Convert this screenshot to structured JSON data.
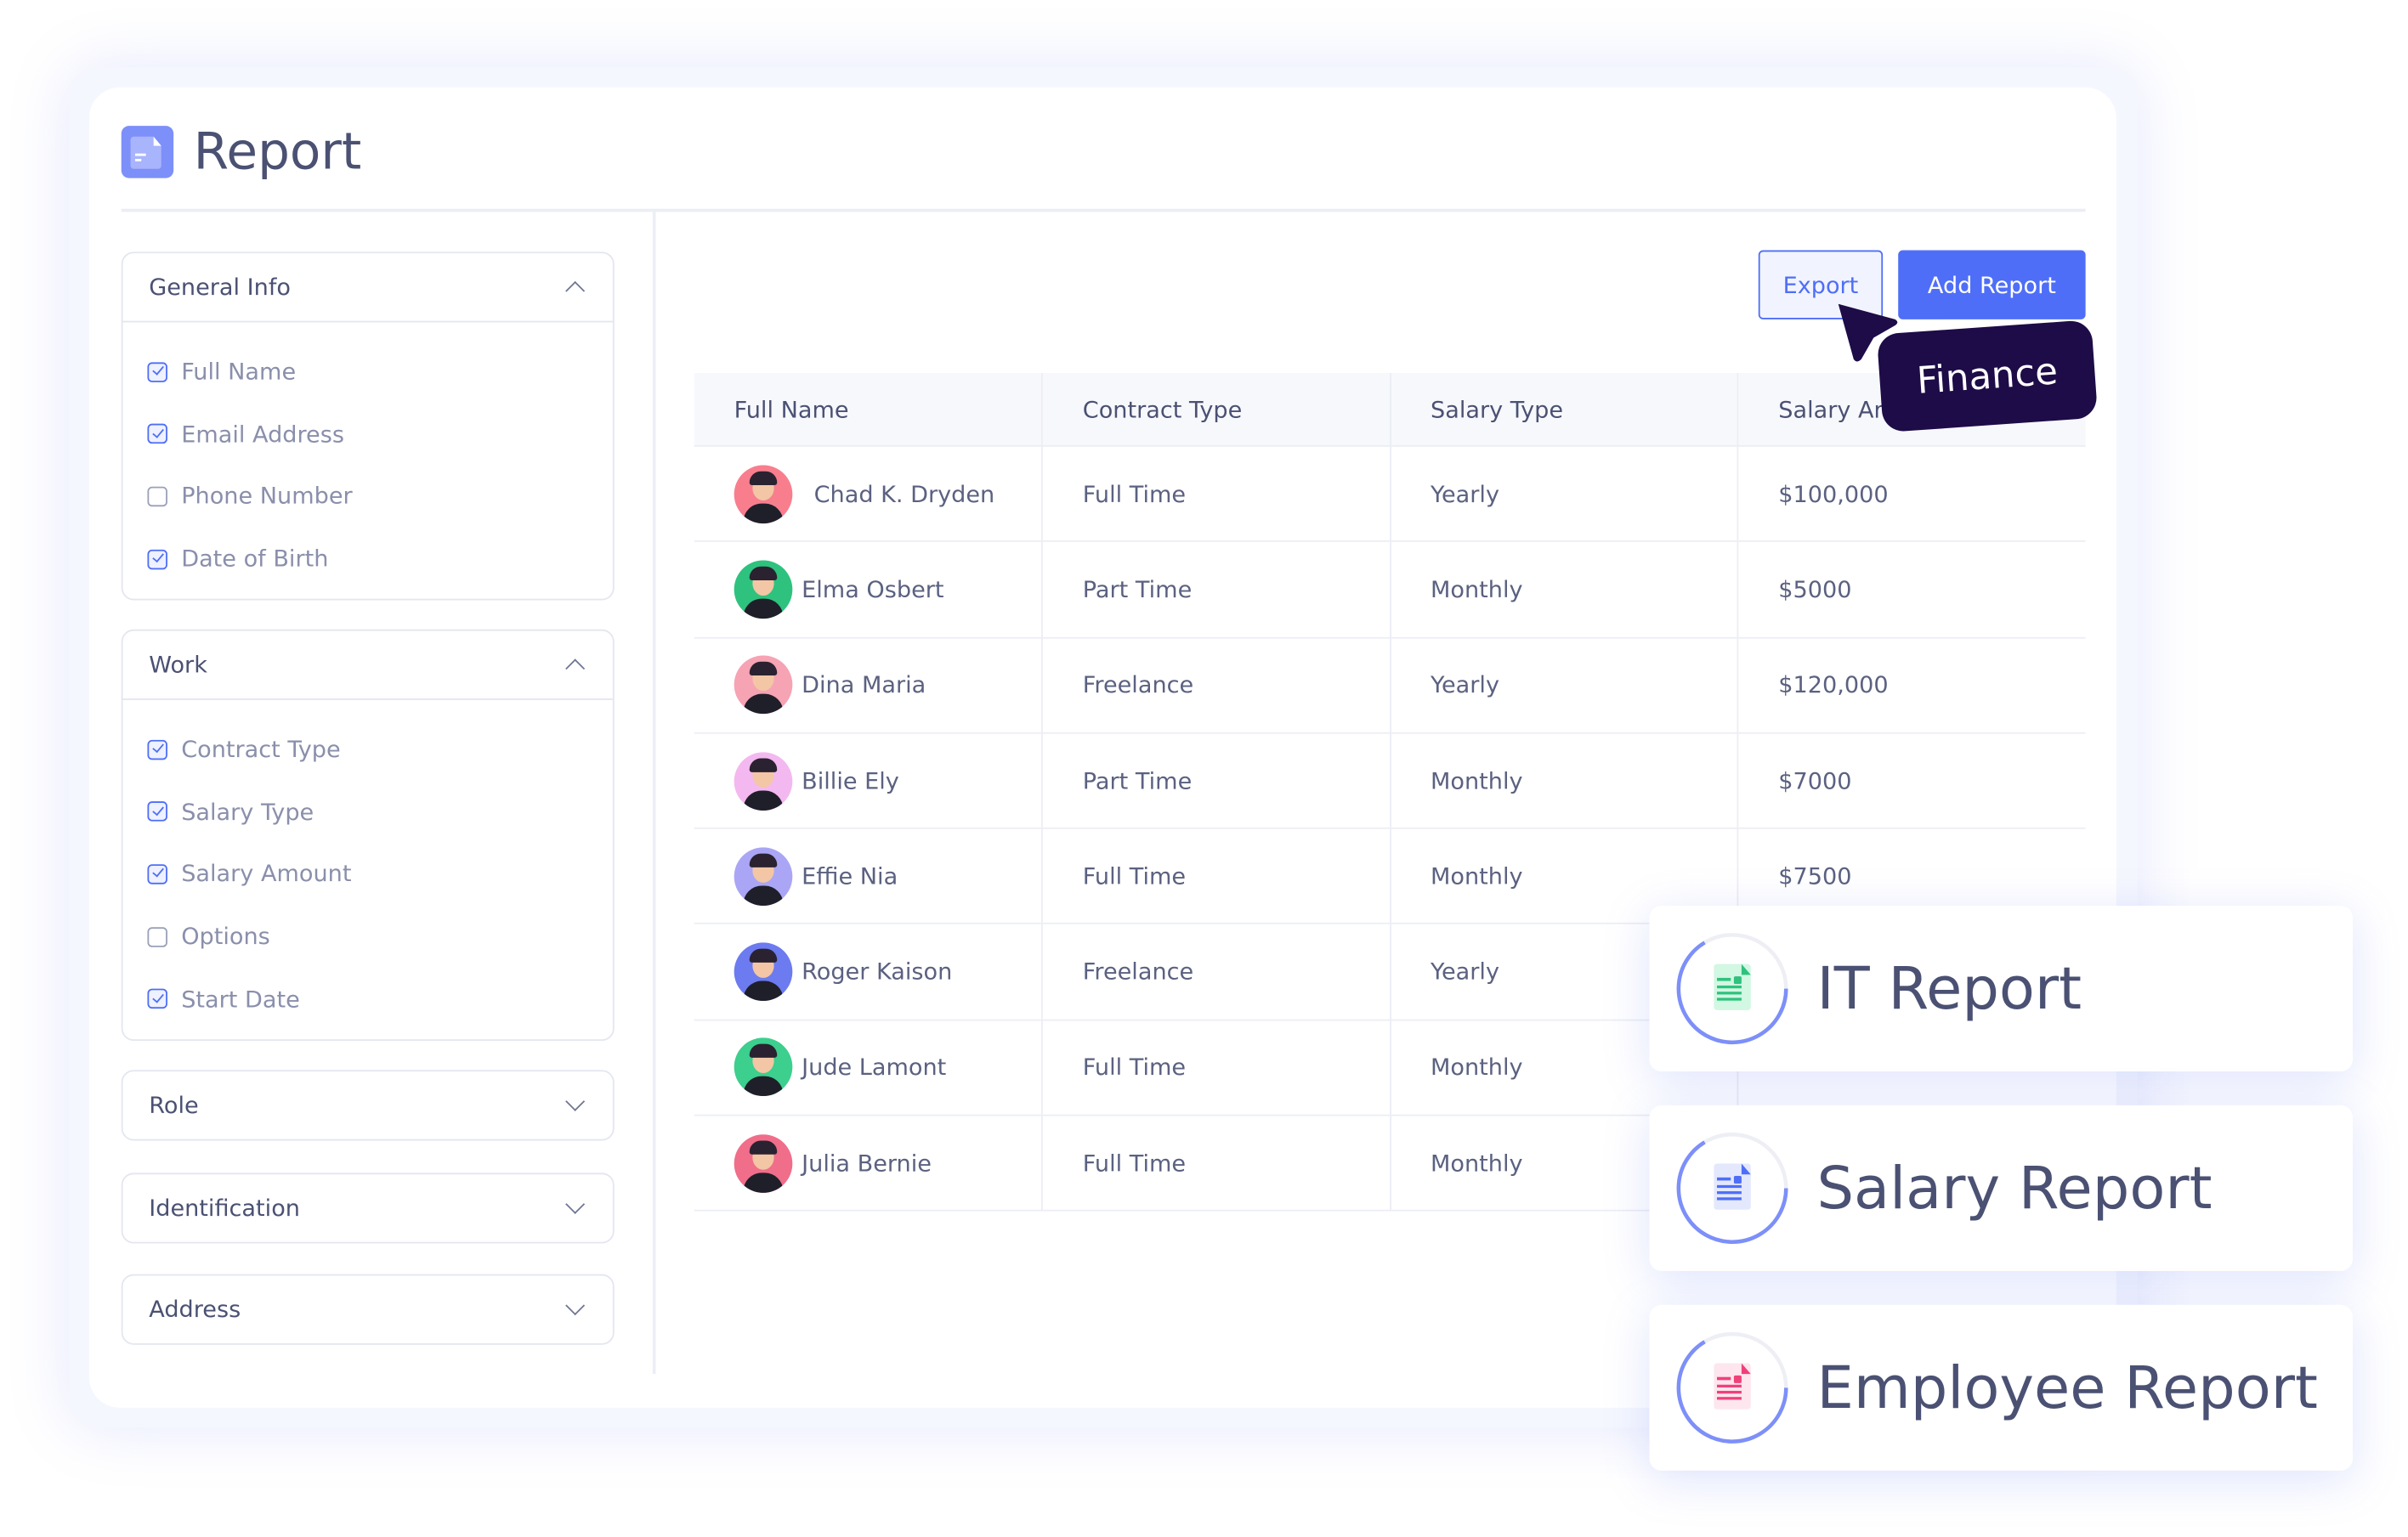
{
  "page": {
    "title": "Report",
    "icon": "document-icon"
  },
  "sidebar": {
    "sections": [
      {
        "label": "General Info",
        "expanded": true,
        "items": [
          {
            "label": "Full Name",
            "checked": true
          },
          {
            "label": "Email Address",
            "checked": true
          },
          {
            "label": "Phone Number",
            "checked": false
          },
          {
            "label": "Date of Birth",
            "checked": true
          }
        ]
      },
      {
        "label": "Work",
        "expanded": true,
        "items": [
          {
            "label": "Contract Type",
            "checked": true
          },
          {
            "label": "Salary Type",
            "checked": true
          },
          {
            "label": "Salary Amount",
            "checked": true
          },
          {
            "label": "Options",
            "checked": false
          },
          {
            "label": "Start Date",
            "checked": true
          }
        ]
      },
      {
        "label": "Role",
        "expanded": false
      },
      {
        "label": "Identification",
        "expanded": false
      },
      {
        "label": "Address",
        "expanded": false
      }
    ]
  },
  "toolbar": {
    "export_label": "Export",
    "add_label": "Add Report"
  },
  "tooltip": {
    "label": "Finance"
  },
  "table": {
    "columns": [
      "Full Name",
      "Contract Type",
      "Salary Type",
      "Salary Amount"
    ],
    "rows": [
      {
        "name": "Chad K. Dryden",
        "contract": "Full Time",
        "salary_type": "Yearly",
        "amount": "$100,000",
        "avatar_color": "#f87e8e"
      },
      {
        "name": "Elma Osbert",
        "contract": "Part Time",
        "salary_type": "Monthly",
        "amount": "$5000",
        "avatar_color": "#2ec27e"
      },
      {
        "name": "Dina Maria",
        "contract": "Freelance",
        "salary_type": "Yearly",
        "amount": "$120,000",
        "avatar_color": "#f6a3b4"
      },
      {
        "name": "Billie Ely",
        "contract": "Part Time",
        "salary_type": "Monthly",
        "amount": "$7000",
        "avatar_color": "#f4b8f0"
      },
      {
        "name": "Effie Nia",
        "contract": "Full Time",
        "salary_type": "Monthly",
        "amount": "$7500",
        "avatar_color": "#aaa6f5"
      },
      {
        "name": "Roger Kaison",
        "contract": "Freelance",
        "salary_type": "Yearly",
        "amount": "",
        "avatar_color": "#6c7bf0"
      },
      {
        "name": "Jude Lamont",
        "contract": "Full Time",
        "salary_type": "Monthly",
        "amount": "",
        "avatar_color": "#3ccf8e"
      },
      {
        "name": "Julia Bernie",
        "contract": "Full Time",
        "salary_type": "Monthly",
        "amount": "",
        "avatar_color": "#f06e8a"
      }
    ]
  },
  "report_cards": [
    {
      "label": "IT Report",
      "icon": "green-document-icon",
      "color": "#2ec27e",
      "tint": "#d2f7e2"
    },
    {
      "label": "Salary Report",
      "icon": "blue-document-icon",
      "color": "#4f6ef7",
      "tint": "#e3e8fd"
    },
    {
      "label": "Employee Report",
      "icon": "pink-document-icon",
      "color": "#f0407a",
      "tint": "#fde6ee"
    }
  ],
  "colors": {
    "accent": "#4f6ef7",
    "tooltip_bg": "#1d0c47",
    "text": "#4b5173"
  }
}
